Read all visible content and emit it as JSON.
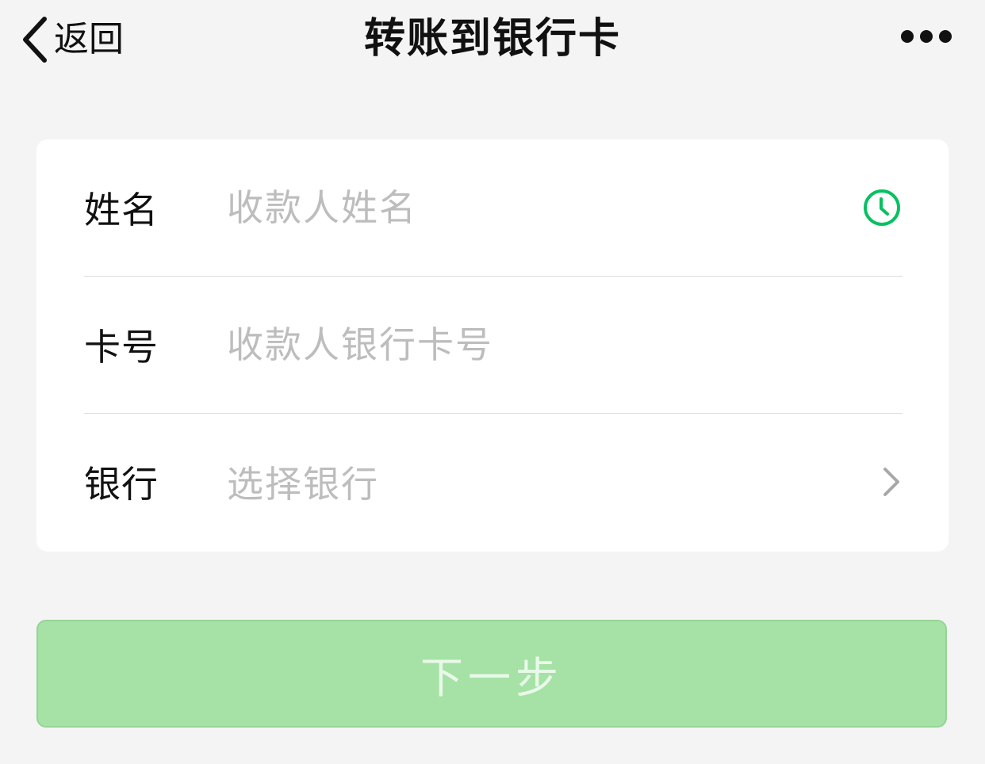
{
  "nav": {
    "back_label": "返回",
    "title": "转账到银行卡"
  },
  "form": {
    "name": {
      "label": "姓名",
      "placeholder": "收款人姓名"
    },
    "card": {
      "label": "卡号",
      "placeholder": "收款人银行卡号"
    },
    "bank": {
      "label": "银行",
      "placeholder": "选择银行"
    }
  },
  "actions": {
    "next_label": "下一步"
  },
  "icons": {
    "back": "chevron-left-icon",
    "more": "more-dots-icon",
    "history": "clock-icon",
    "bank_select": "chevron-right-icon"
  },
  "colors": {
    "accent": "#07c160",
    "button_disabled": "#a6e2a6",
    "background": "#f4f4f4",
    "placeholder": "#bdbdbd"
  }
}
